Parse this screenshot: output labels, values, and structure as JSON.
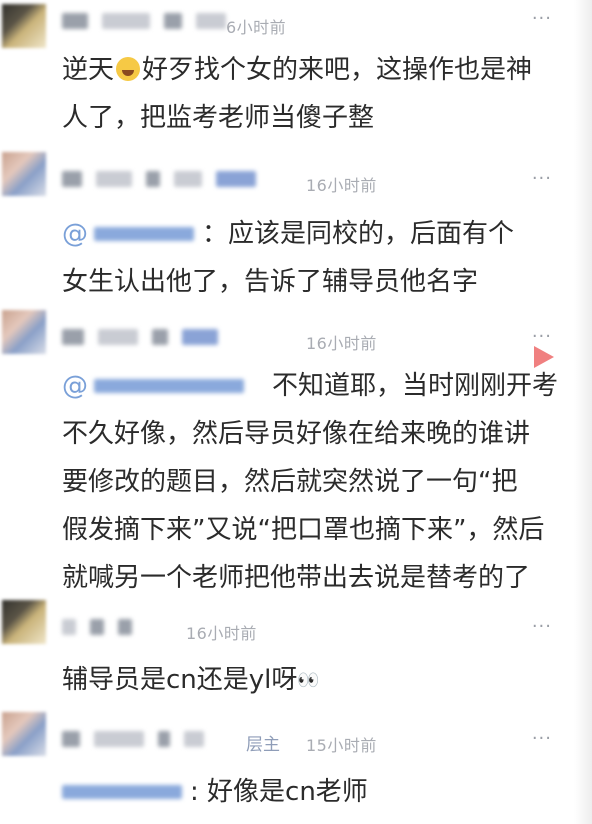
{
  "comments": [
    {
      "time": "6小时前",
      "more": "···",
      "lines": [
        "逆天",
        "好歹找个女的来吧，这操作也是神",
        "人了，把监考老师当傻子整"
      ]
    },
    {
      "time": "16小时前",
      "more": "···",
      "at": "@",
      "lines": [
        "：应该是同校的，后面有个",
        "女生认出他了，告诉了辅导员他名字"
      ]
    },
    {
      "time": "16小时前",
      "more": "···",
      "at": "@",
      "lines": [
        "不知道耶，当时刚刚开考",
        "不久好像，然后导员好像在给来晚的谁讲",
        "要修改的题目，然后就突然说了一句“把",
        "假发摘下来”又说“把口罩也摘下来”，然后",
        "就喊另一个老师把他带出去说是替考的了"
      ]
    },
    {
      "time": "16小时前",
      "more": "···",
      "lines": [
        "辅导员是cn还是yl呀"
      ],
      "emoji": "👀"
    },
    {
      "time": "15小时前",
      "badge": "层主",
      "more": "···",
      "lines": [
        ": 好像是cn老师"
      ]
    }
  ],
  "icons": {
    "laugh": "laughing-emoji-icon",
    "eyes": "eyes-emoji-icon",
    "report": "red-triangle-icon"
  }
}
